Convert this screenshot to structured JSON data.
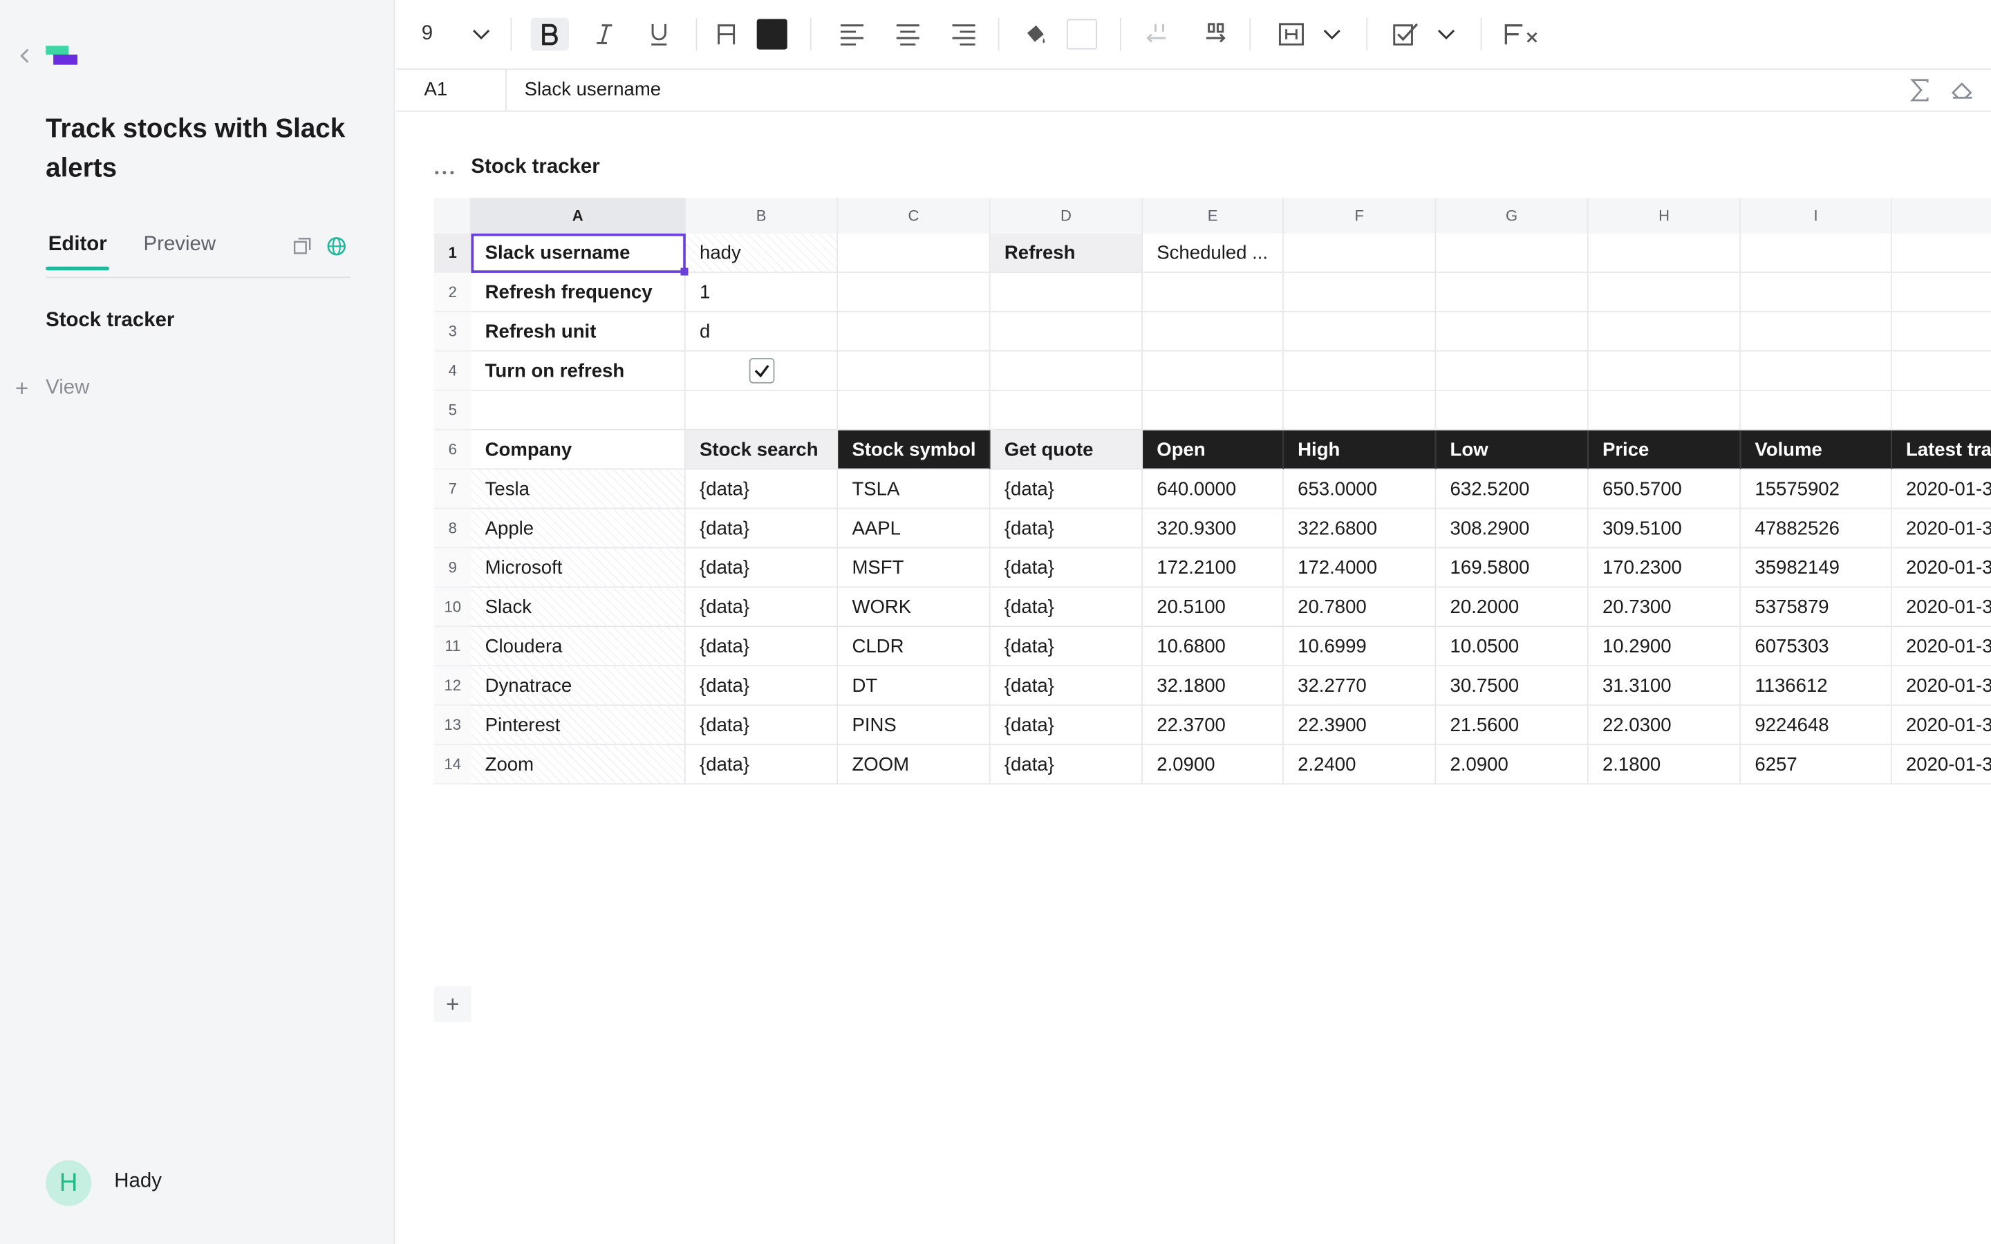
{
  "colors": {
    "accent": "#1fb89c",
    "selection": "#6a41d8",
    "header_dark": "#1f1f1f",
    "logo_green": "#3fd6a5",
    "logo_purple": "#6a2de0"
  },
  "sidebar": {
    "title": "Track stocks with Slack alerts",
    "tabs": [
      {
        "label": "Editor",
        "active": true
      },
      {
        "label": "Preview",
        "active": false
      }
    ],
    "nav_items": [
      {
        "label": "Stock tracker"
      }
    ],
    "add_view_label": "View",
    "user": {
      "initial": "H",
      "name": "Hady"
    }
  },
  "toolbar": {
    "font_size": "9",
    "icons": [
      "chevron-down-icon",
      "bold-icon",
      "italic-icon",
      "underline-icon",
      "text-color-icon",
      "paint-bucket-icon",
      "indent-decrease-icon",
      "indent-increase-icon",
      "merge-icon",
      "checkbox-icon",
      "clear-format-icon"
    ]
  },
  "formula_bar": {
    "cell_ref": "A1",
    "value": "Slack username"
  },
  "sheet": {
    "title": "Stock tracker",
    "columns": [
      "A",
      "B",
      "C",
      "D",
      "E",
      "F",
      "G",
      "H",
      "I",
      ""
    ],
    "selected_column": "A",
    "rows": [
      {
        "n": "1",
        "cells": [
          "Slack username",
          "hady",
          "",
          "Refresh",
          "Scheduled ...",
          "",
          "",
          "",
          "",
          ""
        ]
      },
      {
        "n": "2",
        "cells": [
          "Refresh frequency",
          "1",
          "",
          "",
          "",
          "",
          "",
          "",
          "",
          ""
        ]
      },
      {
        "n": "3",
        "cells": [
          "Refresh unit",
          "d",
          "",
          "",
          "",
          "",
          "",
          "",
          "",
          ""
        ]
      },
      {
        "n": "4",
        "cells": [
          "Turn on refresh",
          "",
          "",
          "",
          "",
          "",
          "",
          "",
          "",
          ""
        ]
      },
      {
        "n": "5",
        "cells": [
          "",
          "",
          "",
          "",
          "",
          "",
          "",
          "",
          "",
          ""
        ]
      },
      {
        "n": "6",
        "cells": [
          "Company",
          "Stock search",
          "Stock symbol",
          "Get quote",
          "Open",
          "High",
          "Low",
          "Price",
          "Volume",
          "Latest tra"
        ]
      },
      {
        "n": "7",
        "cells": [
          "Tesla",
          "{data}",
          "TSLA",
          "{data}",
          "640.0000",
          "653.0000",
          "632.5200",
          "650.5700",
          "15575902",
          "2020-01-3"
        ]
      },
      {
        "n": "8",
        "cells": [
          "Apple",
          "{data}",
          "AAPL",
          "{data}",
          "320.9300",
          "322.6800",
          "308.2900",
          "309.5100",
          "47882526",
          "2020-01-3"
        ]
      },
      {
        "n": "9",
        "cells": [
          "Microsoft",
          "{data}",
          "MSFT",
          "{data}",
          "172.2100",
          "172.4000",
          "169.5800",
          "170.2300",
          "35982149",
          "2020-01-3"
        ]
      },
      {
        "n": "10",
        "cells": [
          "Slack",
          "{data}",
          "WORK",
          "{data}",
          "20.5100",
          "20.7800",
          "20.2000",
          "20.7300",
          "5375879",
          "2020-01-3"
        ]
      },
      {
        "n": "11",
        "cells": [
          "Cloudera",
          "{data}",
          "CLDR",
          "{data}",
          "10.6800",
          "10.6999",
          "10.0500",
          "10.2900",
          "6075303",
          "2020-01-3"
        ]
      },
      {
        "n": "12",
        "cells": [
          "Dynatrace",
          "{data}",
          "DT",
          "{data}",
          "32.1800",
          "32.2770",
          "30.7500",
          "31.3100",
          "1136612",
          "2020-01-3"
        ]
      },
      {
        "n": "13",
        "cells": [
          "Pinterest",
          "{data}",
          "PINS",
          "{data}",
          "22.3700",
          "22.3900",
          "21.5600",
          "22.0300",
          "9224648",
          "2020-01-3"
        ]
      },
      {
        "n": "14",
        "cells": [
          "Zoom",
          "{data}",
          "ZOOM",
          "{data}",
          "2.0900",
          "2.2400",
          "2.0900",
          "2.1800",
          "6257",
          "2020-01-3"
        ]
      }
    ],
    "checkbox_checked": true,
    "add_row_label": "+"
  }
}
